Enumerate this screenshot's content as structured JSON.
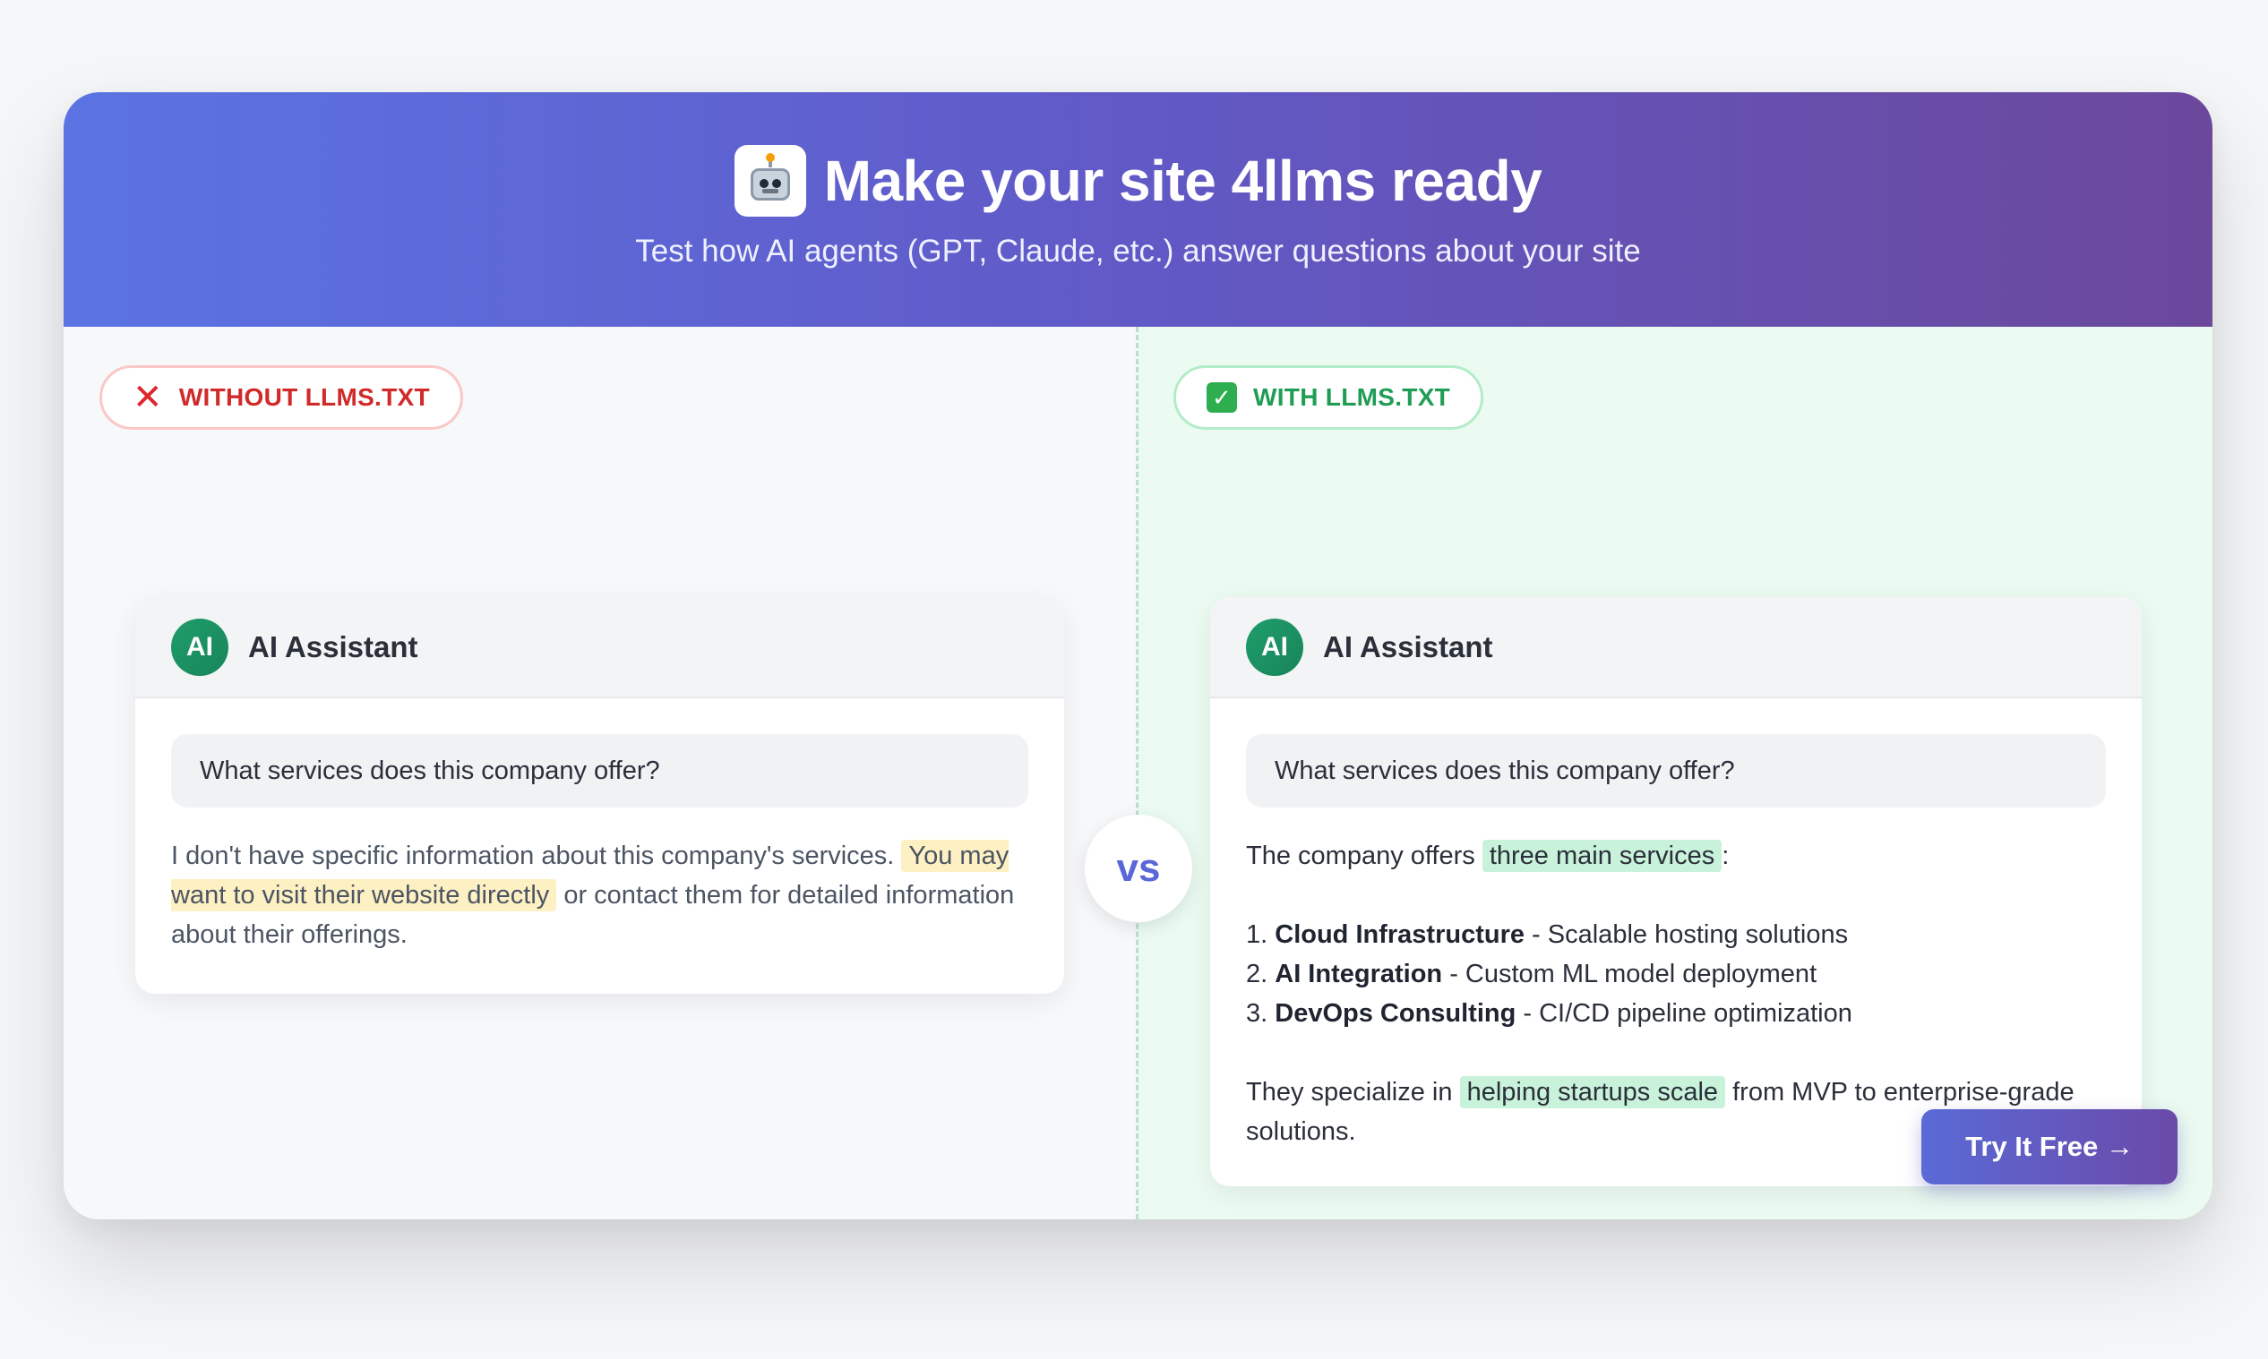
{
  "hero": {
    "title": "Make your site 4llms ready",
    "subtitle": "Test how AI agents (GPT, Claude, etc.) answer questions about your site",
    "icon": "robot-icon",
    "gradient_start": "#5b73e3",
    "gradient_end": "#6b489c"
  },
  "vs_label": "vs",
  "left_panel": {
    "badge_label": "WITHOUT LLMS.TXT",
    "badge_icon": "cross-mark-icon",
    "badge_color": "#d12a2a",
    "chat": {
      "avatar_text": "AI",
      "assistant_name": "AI Assistant",
      "question": "What services does this company offer?",
      "answer_part1": "I don't have specific information about this company's services. ",
      "answer_highlight": "You may want to visit their website directly",
      "answer_part2": " or contact them for detailed information about their offerings."
    }
  },
  "right_panel": {
    "badge_label": "WITH LLMS.TXT",
    "badge_icon": "check-mark-icon",
    "badge_color": "#1f9d55",
    "chat": {
      "avatar_text": "AI",
      "assistant_name": "AI Assistant",
      "question": "What services does this company offer?",
      "intro_part1": "The company offers ",
      "intro_highlight": "three main services",
      "intro_part2": ":",
      "services": [
        {
          "number": "1.",
          "name": "Cloud Infrastructure",
          "desc": " - Scalable hosting solutions"
        },
        {
          "number": "2.",
          "name": "AI Integration",
          "desc": " - Custom ML model deployment"
        },
        {
          "number": "3.",
          "name": "DevOps Consulting",
          "desc": " - CI/CD pipeline optimization"
        }
      ],
      "closing_part1": "They specialize in ",
      "closing_highlight": "helping startups scale",
      "closing_part2": " from MVP to enterprise-grade solutions."
    }
  },
  "cta": {
    "label": "Try It Free →"
  }
}
